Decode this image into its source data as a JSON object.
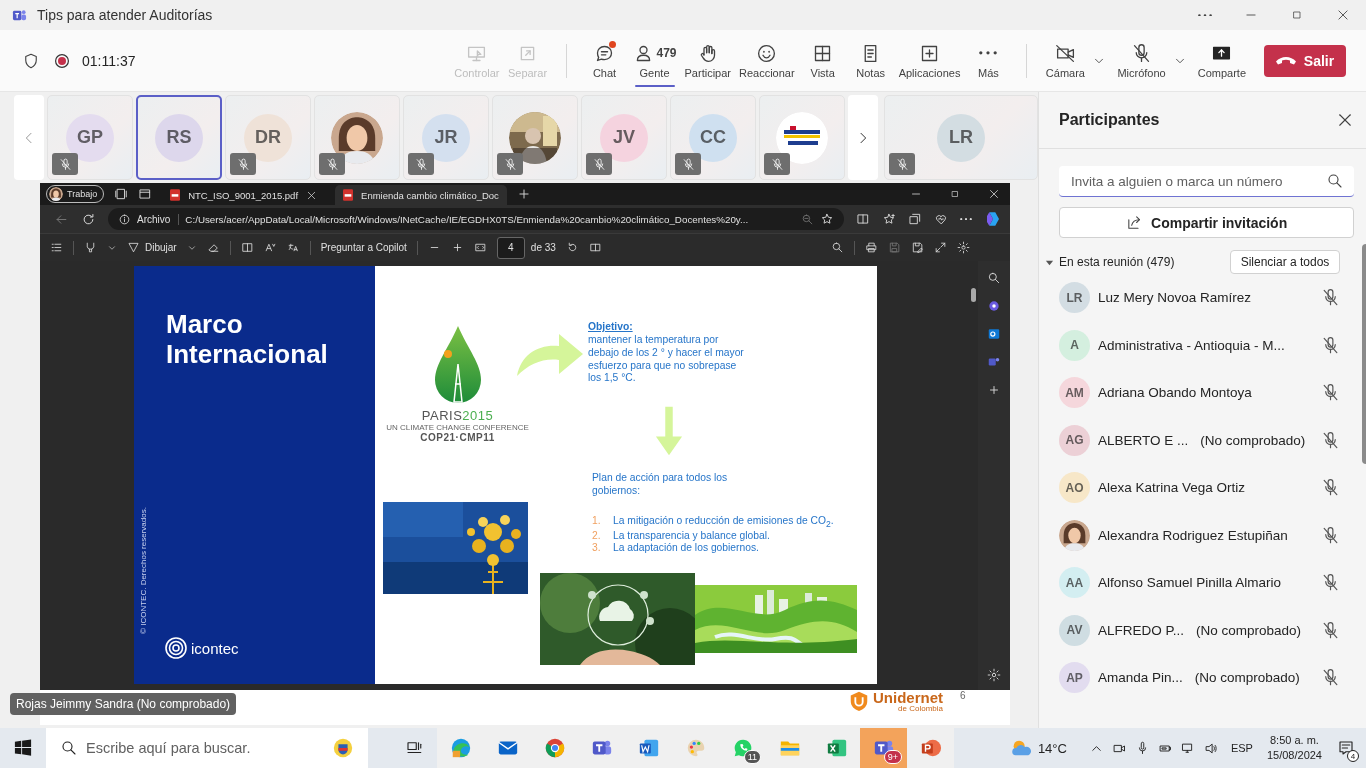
{
  "window": {
    "title": "Tips para atender Auditorías"
  },
  "call_bar": {
    "timer": "01:11:37",
    "recording": true,
    "actions": [
      {
        "label": "Controlar",
        "disabled": true,
        "selected": false,
        "notification": false
      },
      {
        "label": "Separar",
        "disabled": true,
        "selected": false,
        "notification": false
      },
      {
        "label": "Chat",
        "disabled": false,
        "selected": false,
        "notification": true
      },
      {
        "label": "Gente",
        "count": "479",
        "disabled": false,
        "selected": true,
        "notification": false
      },
      {
        "label": "Participar",
        "disabled": false,
        "selected": false,
        "notification": false
      },
      {
        "label": "Reaccionar",
        "disabled": false,
        "selected": false,
        "notification": false
      },
      {
        "label": "Vista",
        "disabled": false,
        "selected": false,
        "notification": false
      },
      {
        "label": "Notas",
        "disabled": false,
        "selected": false,
        "notification": false
      },
      {
        "label": "Aplicaciones",
        "disabled": false,
        "selected": false,
        "notification": false
      },
      {
        "label": "Más",
        "disabled": false,
        "selected": false,
        "notification": false
      }
    ],
    "devices": [
      {
        "kind": "camera",
        "label": "Cámara",
        "on": false,
        "dropdown": true
      },
      {
        "kind": "microphone",
        "label": "Micrófono",
        "on": false,
        "dropdown": true
      },
      {
        "kind": "share",
        "label": "Comparte",
        "dropdown": false
      }
    ],
    "leave_button": "Salir"
  },
  "participant_strip": {
    "tiles": [
      {
        "kind": "initials",
        "initials": "GP",
        "color": "#e4dcef",
        "muted": true,
        "selected": false
      },
      {
        "kind": "initials",
        "initials": "RS",
        "color": "#ddd7ec",
        "muted": false,
        "selected": true
      },
      {
        "kind": "initials",
        "initials": "DR",
        "color": "#efe2d8",
        "muted": true,
        "selected": false
      },
      {
        "kind": "picture",
        "muted": true,
        "selected": false
      },
      {
        "kind": "initials",
        "initials": "JR",
        "color": "#d4e0ef",
        "muted": true,
        "selected": false
      },
      {
        "kind": "picture",
        "muted": true,
        "selected": false
      },
      {
        "kind": "initials",
        "initials": "JV",
        "color": "#f5d3df",
        "muted": true,
        "selected": false
      },
      {
        "kind": "initials",
        "initials": "CC",
        "color": "#cfe0f0",
        "muted": true,
        "selected": false
      },
      {
        "kind": "picture",
        "muted": true,
        "selected": false
      },
      {
        "kind": "initials",
        "initials": "LR",
        "color": "#d3dde2",
        "muted": true,
        "selected": false
      }
    ]
  },
  "browser": {
    "profile": "Trabajo",
    "tabs": [
      {
        "label": "NTC_ISO_9001_2015.pdf",
        "selected": false
      },
      {
        "label": "Enmienda cambio climático_Doc",
        "selected": true
      }
    ],
    "address_prefix": "Archivo",
    "url": "C:/Users/acer/AppData/Local/Microsoft/Windows/INetCache/IE/EGDHX0TS/Enmienda%20cambio%20climático_Docentes%20y...",
    "pdf_toolbar": {
      "draw": "Dibujar",
      "copilot": "Preguntar a Copilot",
      "page": "4",
      "page_total": "de 33"
    }
  },
  "slide": {
    "title": "Marco Internacional",
    "copyright": "© ICONTEC. Derechos reservados.",
    "brand": "icontec",
    "logo": {
      "city": "PARIS",
      "year": "2015",
      "subtitle": "UN CLIMATE CHANGE CONFERENCE",
      "code": "COP21·CMP11"
    },
    "objective_heading": "Objetivo:",
    "objective_text": "mantener la temperatura por debajo de los 2 ° y hacer el mayor esfuerzo para que no sobrepase los 1,5 °C.",
    "plan_heading": "Plan de acción para todos los gobiernos:",
    "plan_items": [
      {
        "number": "1.",
        "text": "La mitigación o reducción de emisiones de CO$_{2}$."
      },
      {
        "number": "2.",
        "text": "La transparencia y balance global."
      },
      {
        "number": "3.",
        "text": "La adaptación de los gobiernos."
      }
    ]
  },
  "desktop_logo": {
    "name": "Unidernet",
    "tagline": "de Colombia",
    "page": "6"
  },
  "speaker_label": "Rojas Jeimmy Sandra (No comprobado)",
  "participants_panel": {
    "title": "Participantes",
    "search_placeholder": "Invita a alguien o marca un número",
    "share_button": "Compartir invitación",
    "section": {
      "label": "En esta reunión (479)",
      "expanded": true
    },
    "mute_all": "Silenciar a todos",
    "people": [
      {
        "kind": "initials",
        "initials": "LR",
        "color": "#d3dde3",
        "name": "Luz Mery Novoa Ramírez",
        "muted": true
      },
      {
        "kind": "initials",
        "initials": "A",
        "color": "#d4efdf",
        "name": "Administrativa - Antioquia - M...",
        "muted": true
      },
      {
        "kind": "initials",
        "initials": "AM",
        "color": "#f5d7dc",
        "name": "Adriana Obando Montoya",
        "muted": true
      },
      {
        "kind": "initials",
        "initials": "AG",
        "color": "#ecd0d6",
        "name": "ALBERTO E ...",
        "status": "(No comprobado)",
        "muted": true
      },
      {
        "kind": "initials",
        "initials": "AO",
        "color": "#f7e7c8",
        "name": "Alexa Katrina Vega Ortiz",
        "muted": true
      },
      {
        "kind": "picture",
        "name": "Alexandra Rodriguez Estupiñan",
        "muted": true
      },
      {
        "kind": "initials",
        "initials": "AA",
        "color": "#d3eef1",
        "name": "Alfonso Samuel Pinilla Almario",
        "muted": true
      },
      {
        "kind": "initials",
        "initials": "AV",
        "color": "#cfdde2",
        "name": "ALFREDO P...",
        "status": "(No comprobado)",
        "muted": true
      },
      {
        "kind": "initials",
        "initials": "AP",
        "color": "#e2dcef",
        "name": "Amanda Pin...",
        "status": "(No comprobado)",
        "muted": true
      }
    ]
  },
  "taskbar": {
    "search_placeholder": "Escribe aquí para buscar.",
    "apps": [
      {
        "selected": false
      },
      {
        "selected": false
      },
      {
        "selected": false
      },
      {
        "selected": false
      },
      {
        "selected": false
      },
      {
        "selected": false
      },
      {
        "selected": false,
        "badge": "11"
      },
      {
        "selected": false
      },
      {
        "selected": false
      },
      {
        "selected": true,
        "badge": "9+"
      },
      {
        "selected": false
      }
    ],
    "weather": "14°C",
    "language": "ESP",
    "time": "8:50 a. m.",
    "date": "15/08/2024",
    "notifications": "4"
  }
}
